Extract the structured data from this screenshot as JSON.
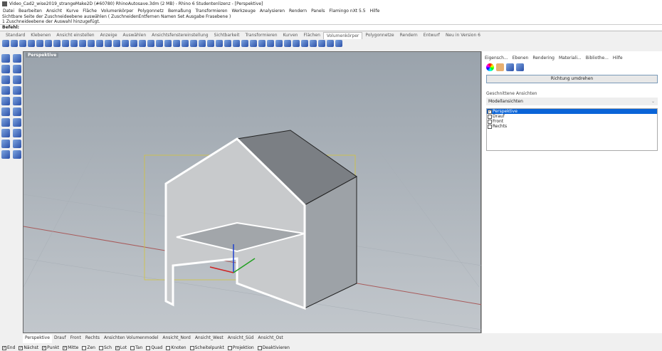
{
  "window": {
    "title": "Video_Cad2_wise2019_strangeMake2D (#60780) RhinoAutosave.3dm (2 MB) - Rhino 6 Studentenlizenz - [Perspektive]"
  },
  "menu": [
    "Datei",
    "Bearbeiten",
    "Ansicht",
    "Kurve",
    "Fläche",
    "Volumenkörper",
    "Polygonnetz",
    "Bemaßung",
    "Transformieren",
    "Werkzeuge",
    "Analysieren",
    "Rendern",
    "Panels",
    "Flamingo nXt 5.5",
    "Hilfe"
  ],
  "command": {
    "history": [
      "Sichtbare Seite der Zuschneideebene auswählen ( ZuschneidenEntfernen Namen Set Ausgabe Frasebene )",
      "1 Zuschneideebene der Auswahl hinzugefügt."
    ],
    "prompt": "Befehl:"
  },
  "toolbar_tabs": [
    "Standard",
    "Klebenen",
    "Ansicht einstellen",
    "Anzeige",
    "Auswählen",
    "Ansichtsfenstereinstellung",
    "Sichtbarkeit",
    "Transformieren",
    "Kurven",
    "Flächen",
    "Volumenkörper",
    "Polygonnetze",
    "Rendern",
    "Entwurf",
    "Neu in Version 6"
  ],
  "active_toolbar_tab": "Volumenkörper",
  "viewport": {
    "label": "Perspektive"
  },
  "viewport_tabs": [
    "Perspektive",
    "Drauf",
    "Front",
    "Rechts",
    "Ansichten Volumenmodel",
    "Ansicht_Nord",
    "Ansicht_West",
    "Ansicht_Süd",
    "Ansicht_Ost"
  ],
  "osnaps": [
    {
      "label": "End",
      "checked": true
    },
    {
      "label": "Nächst",
      "checked": true
    },
    {
      "label": "Punkt",
      "checked": true
    },
    {
      "label": "Mitte",
      "checked": true
    },
    {
      "label": "Zen",
      "checked": false
    },
    {
      "label": "Sch",
      "checked": false
    },
    {
      "label": "Lot",
      "checked": true
    },
    {
      "label": "Tan",
      "checked": false
    },
    {
      "label": "Quad",
      "checked": false
    },
    {
      "label": "Knoten",
      "checked": false
    },
    {
      "label": "Scheitelpunkt",
      "checked": false
    },
    {
      "label": "Projektion",
      "checked": false
    },
    {
      "label": "Deaktivieren",
      "checked": false
    }
  ],
  "panel": {
    "tabs": [
      "Eigensch...",
      "Ebenen",
      "Rendering",
      "Materiali...",
      "Bibliothe...",
      "Hilfe"
    ],
    "flip_button": "Richtung umdrehen",
    "named_views_label": "Geschnittene Ansichten",
    "dropdown_value": "Modellansichten",
    "views": [
      {
        "label": "Perspektive",
        "checked": true,
        "selected": true
      },
      {
        "label": "Drauf",
        "checked": false
      },
      {
        "label": "Front",
        "checked": false
      },
      {
        "label": "Rechts",
        "checked": false
      }
    ]
  }
}
